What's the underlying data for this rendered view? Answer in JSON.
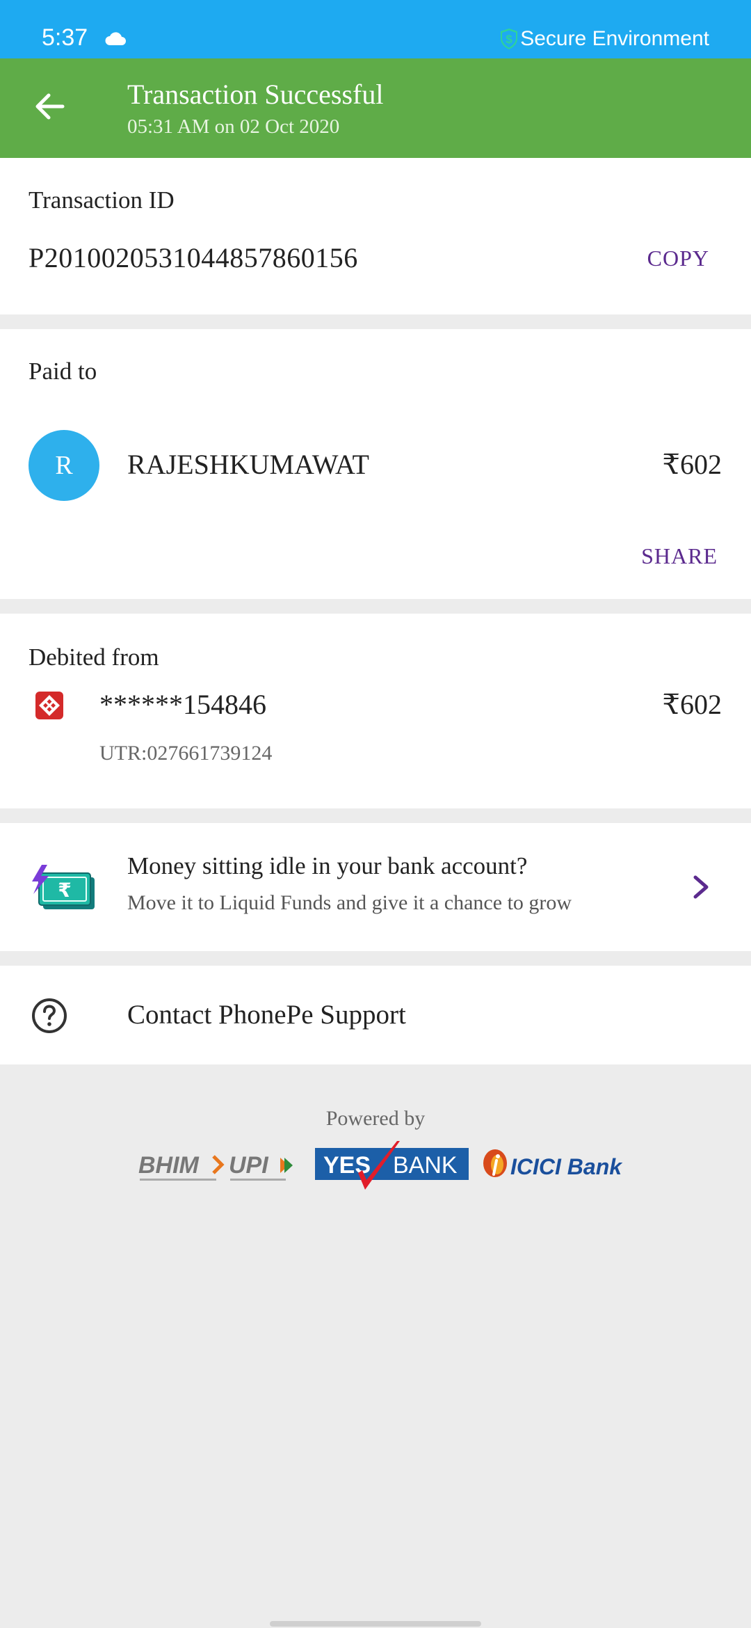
{
  "status_bar": {
    "time": "5:37",
    "secure_text": "Secure Environment",
    "icons": [
      "cloud-icon",
      "shield-dollar-icon"
    ]
  },
  "header": {
    "title": "Transaction Successful",
    "subtitle": "05:31 AM on 02 Oct 2020",
    "back_icon": "back-arrow-icon"
  },
  "transaction": {
    "label": "Transaction ID",
    "id": "P2010020531044857860156",
    "copy_label": "COPY"
  },
  "paid_to": {
    "label": "Paid to",
    "avatar_initial": "R",
    "name": "RAJESHKUMAWAT",
    "amount": "₹602",
    "share_label": "SHARE"
  },
  "debited": {
    "label": "Debited from",
    "account": "******154846",
    "utr": "UTR:027661739124",
    "amount": "₹602",
    "bank_icon": "bank-logo-icon"
  },
  "promo": {
    "title": "Money sitting idle in your bank account?",
    "subtitle": "Move it to Liquid Funds and give it a chance to grow",
    "icon": "money-icon"
  },
  "support": {
    "label": "Contact PhonePe Support",
    "icon": "help-icon"
  },
  "footer": {
    "powered_by": "Powered by",
    "logo_bhim": "BHIM",
    "logo_upi": "UPI",
    "logo_yes": "YES",
    "logo_bank": "BANK",
    "logo_icici": "ICICI Bank"
  },
  "colors": {
    "status_bar": "#1eaaf1",
    "header": "#5fac48",
    "accent_purple": "#5b2a8e",
    "avatar": "#2eb0ec",
    "background": "#ececec"
  }
}
